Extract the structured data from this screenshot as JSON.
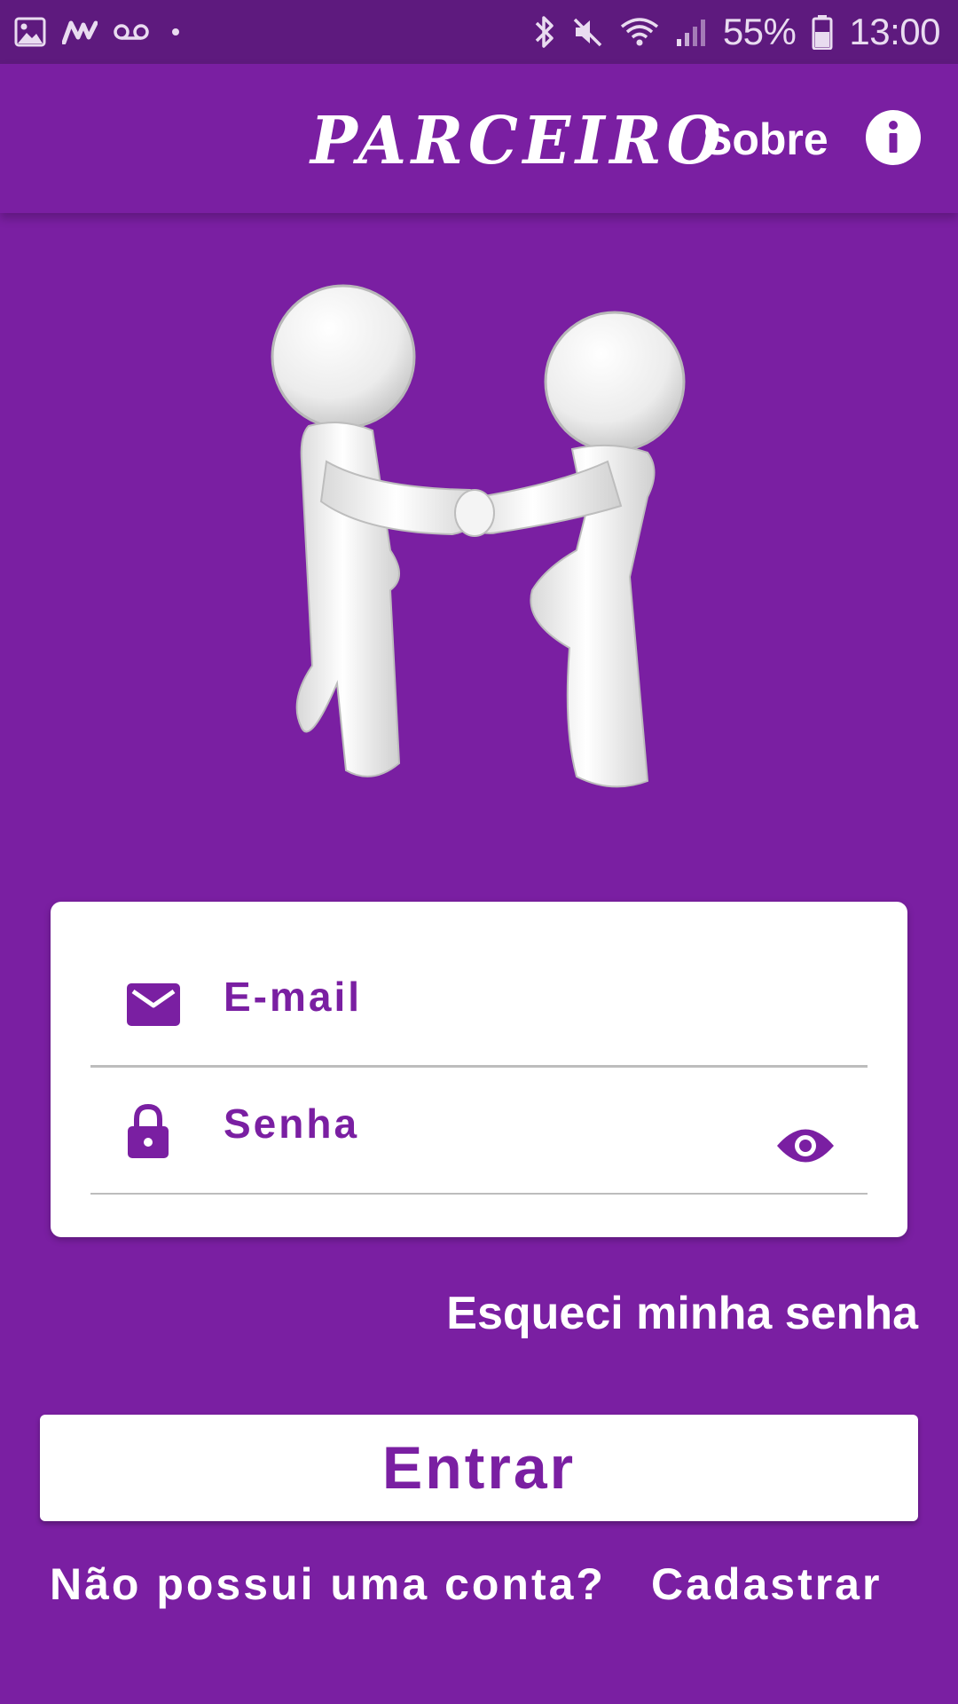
{
  "status_bar": {
    "battery_percent": "55%",
    "time": "13:00",
    "icons": [
      "image-icon",
      "m-app-icon",
      "voicemail-icon",
      "dot-icon",
      "bluetooth-icon",
      "mute-icon",
      "wifi-icon",
      "signal-icon",
      "battery-icon"
    ]
  },
  "app_bar": {
    "title": "PARCEIRO",
    "about_label": "Sobre",
    "info_icon": "info-icon"
  },
  "illustration": {
    "icon": "handshake-figures-illustration"
  },
  "login_form": {
    "email_placeholder": "E-mail",
    "password_placeholder": "Senha",
    "email_icon": "mail-icon",
    "password_icon": "lock-icon",
    "toggle_icon": "eye-icon"
  },
  "forgot_password_label": "Esqueci minha senha",
  "login_button_label": "Entrar",
  "signup": {
    "prompt": "Não possui uma conta?",
    "link_label": "Cadastrar"
  },
  "colors": {
    "primary": "#7a1fa2",
    "status_bar": "#5e1a7e",
    "surface": "#ffffff",
    "divider": "#bdbdbd"
  }
}
